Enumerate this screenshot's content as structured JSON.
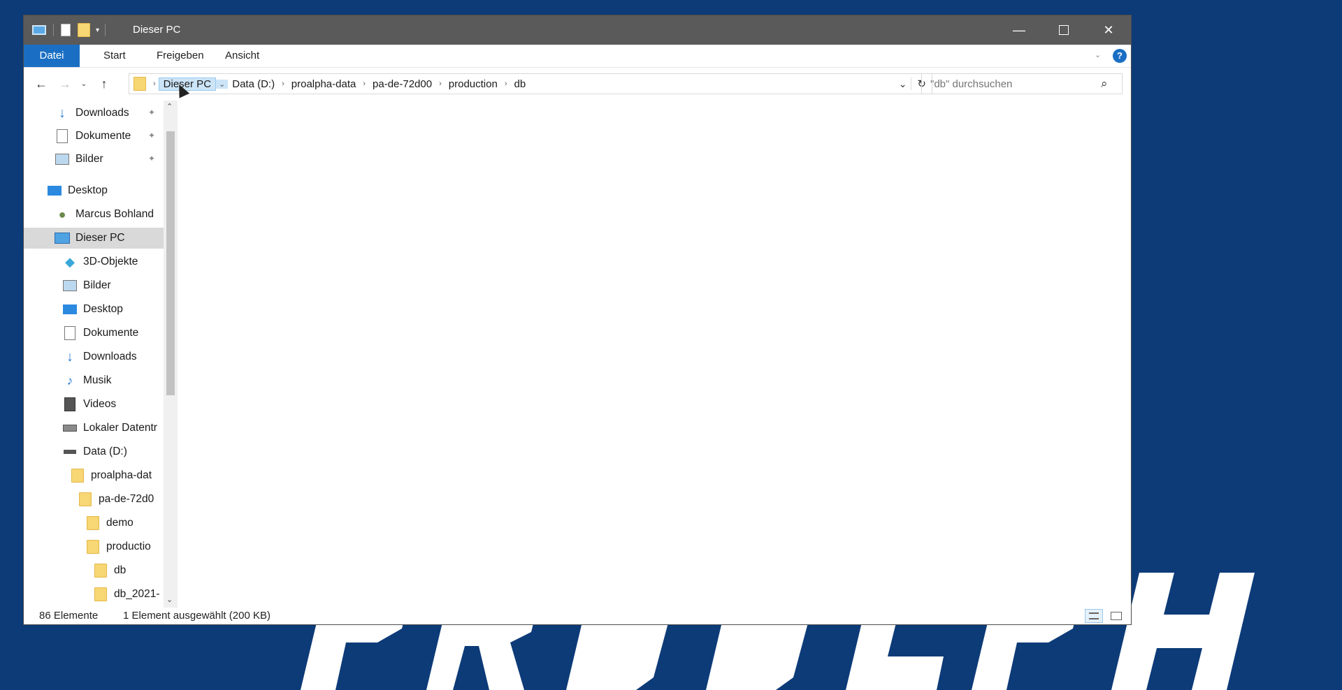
{
  "window": {
    "title": "Dieser PC"
  },
  "ribbon": {
    "tabs": [
      "Datei",
      "Start",
      "Freigeben",
      "Ansicht"
    ]
  },
  "address": {
    "crumbs": [
      "Dieser PC",
      "Data (D:)",
      "proalpha-data",
      "pa-de-72d00",
      "production",
      "db"
    ]
  },
  "search": {
    "placeholder": "\"db\" durchsuchen"
  },
  "nav": {
    "quick": [
      {
        "label": "Downloads",
        "icon": "download-arrow-icon"
      },
      {
        "label": "Dokumente",
        "icon": "document-icon"
      },
      {
        "label": "Bilder",
        "icon": "pictures-icon"
      }
    ],
    "desktop": "Desktop",
    "user": "Marcus Bohland",
    "thispc": "Dieser PC",
    "pc_items": [
      {
        "label": "3D-Objekte",
        "icon": "3d-objects-icon"
      },
      {
        "label": "Bilder",
        "icon": "pictures-icon"
      },
      {
        "label": "Desktop",
        "icon": "desktop-icon"
      },
      {
        "label": "Dokumente",
        "icon": "document-icon"
      },
      {
        "label": "Downloads",
        "icon": "download-arrow-icon"
      },
      {
        "label": "Musik",
        "icon": "music-note-icon"
      },
      {
        "label": "Videos",
        "icon": "video-icon"
      },
      {
        "label": "Lokaler Datentr",
        "icon": "drive-icon"
      },
      {
        "label": "Data (D:)",
        "icon": "drive-icon"
      }
    ],
    "folders": [
      "proalpha-dat",
      "pa-de-72d0",
      "demo",
      "productio",
      "db",
      "db_2021-"
    ]
  },
  "status": {
    "count": "86 Elemente",
    "selection": "1 Element ausgewählt (200 KB)"
  },
  "colors": {
    "accent": "#1a6fc4",
    "background": "#0d3b78",
    "titlebar": "#5a5a5a"
  }
}
